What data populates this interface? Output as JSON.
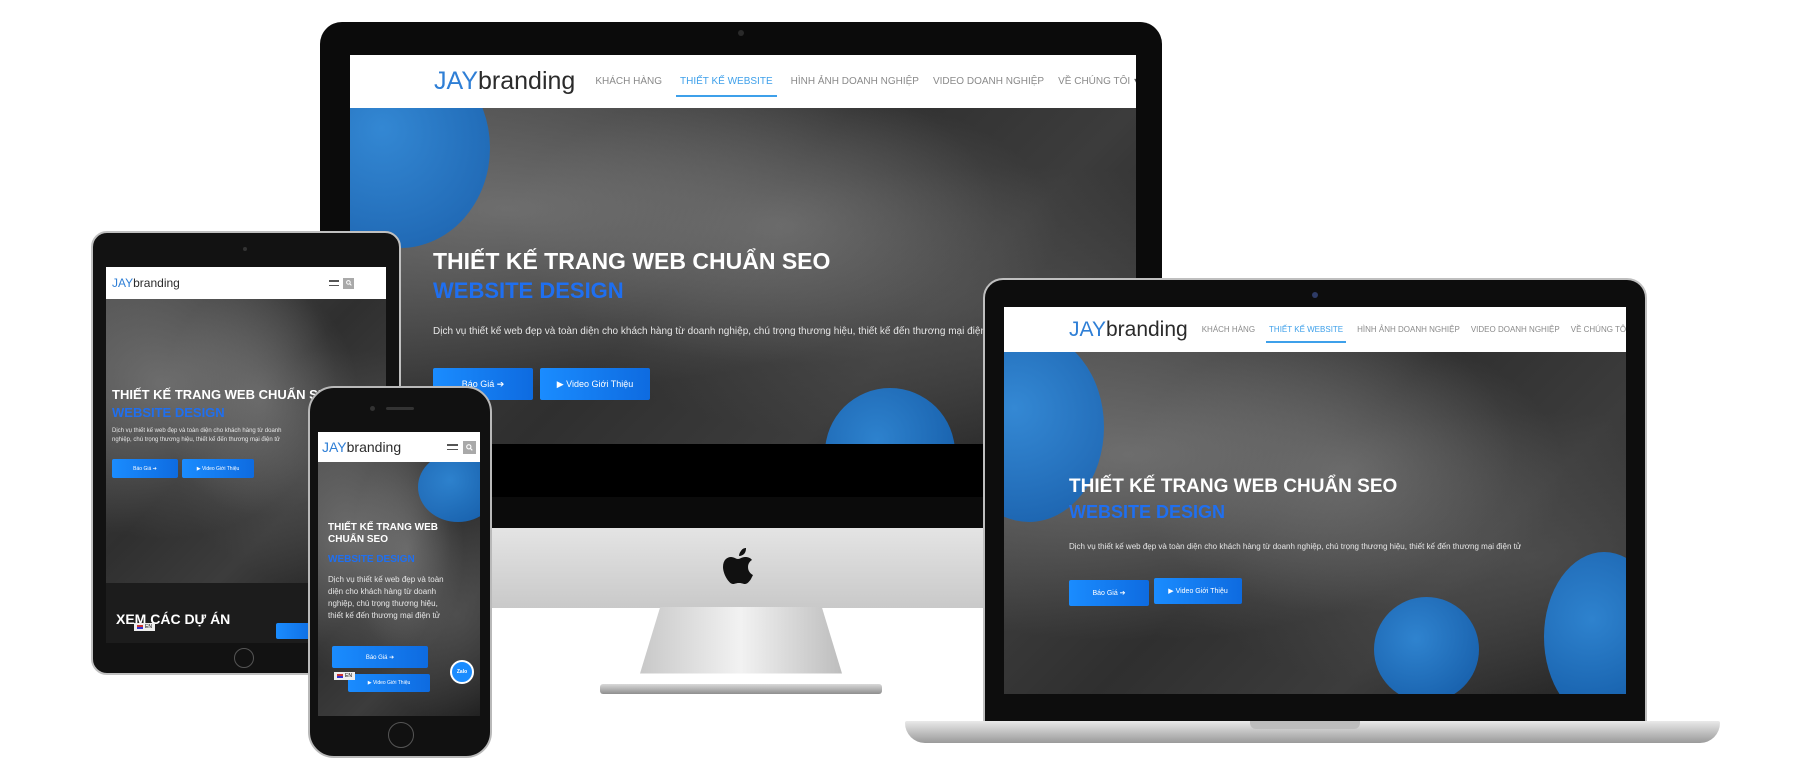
{
  "site": {
    "logo_jay": "JAY",
    "logo_brand": "branding",
    "nav": [
      "KHÁCH HÀNG",
      "THIẾT KẾ WEBSITE",
      "HÌNH ẢNH DOANH NGHIỆP",
      "VIDEO DOANH NGHIỆP",
      "VỀ CHÚNG TÔI"
    ],
    "nav_dropdown_caret": "▾",
    "search_icon": "🔍",
    "hero_title": "THIẾT KẾ TRANG WEB CHUẨN SEO",
    "hero_subtitle": "WEBSITE DESIGN",
    "hero_desc": "Dịch vụ thiết kế web đẹp và toàn diện cho khách hàng từ doanh nghiệp, chú trọng thương hiệu, thiết kế đến thương mại điện tử",
    "btn_quote": "Báo Giá ➔",
    "btn_video": "▶ Video Giới Thiệu",
    "section_projects": "XEM CÁC DỰ ÁN",
    "lang_badge": "EN",
    "zalo_label": "Zalo"
  },
  "colors": {
    "accent": "#3ea0ea",
    "hero_subtitle": "#1f6ff0",
    "button": "#1a8cff"
  },
  "icons": [
    "search-icon",
    "hamburger-menu-icon",
    "apple-logo-icon",
    "play-icon",
    "arrow-right-icon",
    "flag-icon",
    "zalo-chat-icon"
  ]
}
